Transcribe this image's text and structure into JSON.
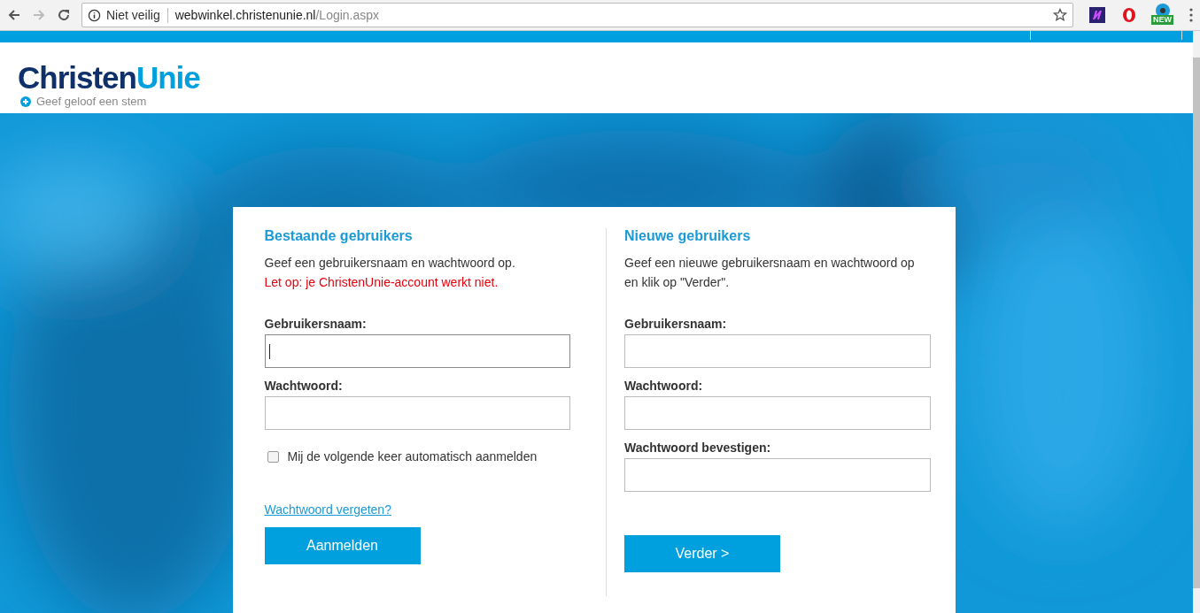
{
  "browser": {
    "security": "Niet veilig",
    "url_host": "webwinkel.christenunie.nl",
    "url_path": "/Login.aspx",
    "extension_badge": "NEW"
  },
  "site": {
    "logo_first": "Christen",
    "logo_second": "Unie",
    "tagline": "Geef geloof een stem"
  },
  "existing": {
    "title": "Bestaande gebruikers",
    "intro": "Geef een gebruikersnaam en wachtwoord op.",
    "warning": "Let op: je ChristenUnie-account werkt niet.",
    "fields": [
      {
        "label": "Gebruikersnaam:",
        "focused": true
      },
      {
        "label": "Wachtwoord:",
        "focused": false
      }
    ],
    "remember": {
      "label": "Mij de volgende keer automatisch aanmelden",
      "checked": false
    },
    "forgot_link": "Wachtwoord vergeten?",
    "submit": "Aanmelden"
  },
  "new_users": {
    "title": "Nieuwe gebruikers",
    "intro": "Geef een nieuwe gebruikersnaam en wachtwoord op en klik op \"Verder\".",
    "fields": [
      {
        "label": "Gebruikersnaam:",
        "focused": false
      },
      {
        "label": "Wachtwoord:",
        "focused": false
      },
      {
        "label": "Wachtwoord bevestigen:",
        "focused": false
      }
    ],
    "submit": "Verder >"
  }
}
